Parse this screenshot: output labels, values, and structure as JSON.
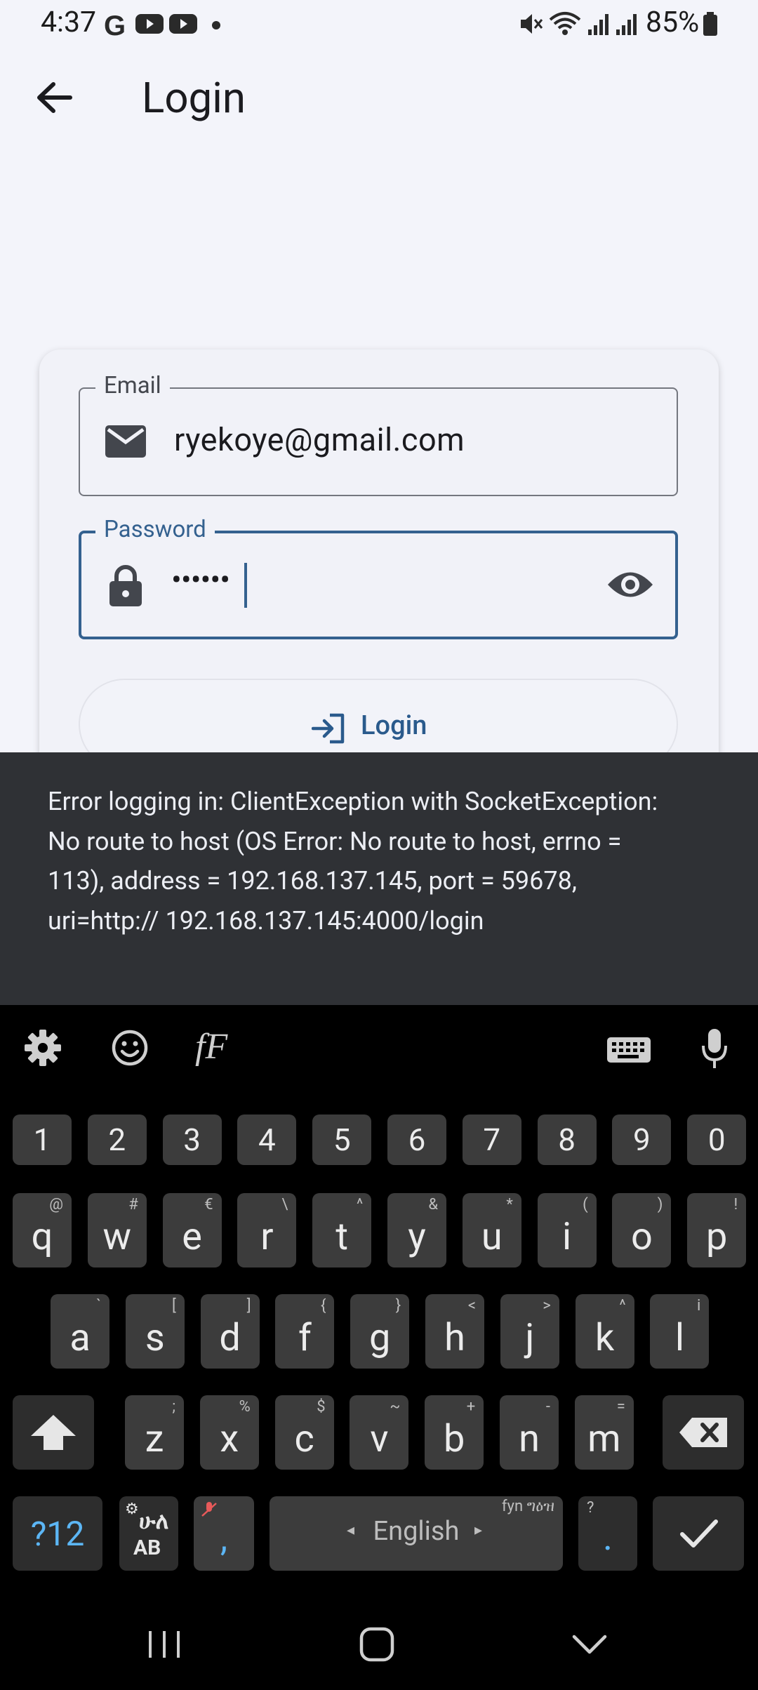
{
  "status_bar": {
    "time": "4:37",
    "battery": "85%",
    "notification_icons": [
      "google-icon",
      "youtube-icon",
      "youtube-icon",
      "dot-icon"
    ],
    "system_icons": [
      "mute-icon",
      "wifi-icon",
      "signal-icon",
      "signal-icon",
      "battery-icon"
    ]
  },
  "app_bar": {
    "title": "Login"
  },
  "form": {
    "email": {
      "label": "Email",
      "value": "ryekoye@gmail.com"
    },
    "password": {
      "label": "Password",
      "value": "••••••"
    },
    "login_button": "Login"
  },
  "snackbar": {
    "message": "Error logging in: ClientException with SocketException: No route to host (OS Error: No route to host, errno = 113), address = 192.168.137.145, port = 59678, uri=http:// 192.168.137.145:4000/login"
  },
  "keyboard": {
    "toolbar": {
      "font_label": "fF"
    },
    "number_row": [
      "1",
      "2",
      "3",
      "4",
      "5",
      "6",
      "7",
      "8",
      "9",
      "0"
    ],
    "row1": [
      {
        "k": "q",
        "s": "@"
      },
      {
        "k": "w",
        "s": "#"
      },
      {
        "k": "e",
        "s": "€"
      },
      {
        "k": "r",
        "s": "\\"
      },
      {
        "k": "t",
        "s": "^"
      },
      {
        "k": "y",
        "s": "&"
      },
      {
        "k": "u",
        "s": "*"
      },
      {
        "k": "i",
        "s": "("
      },
      {
        "k": "o",
        "s": ")"
      },
      {
        "k": "p",
        "s": "!"
      }
    ],
    "row2": [
      {
        "k": "a",
        "s": "`"
      },
      {
        "k": "s",
        "s": "["
      },
      {
        "k": "d",
        "s": "]"
      },
      {
        "k": "f",
        "s": "{"
      },
      {
        "k": "g",
        "s": "}"
      },
      {
        "k": "h",
        "s": "<"
      },
      {
        "k": "j",
        "s": ">"
      },
      {
        "k": "k",
        "s": "^"
      },
      {
        "k": "l",
        "s": "i"
      }
    ],
    "row3": [
      {
        "k": "z",
        "s": ";"
      },
      {
        "k": "x",
        "s": "%"
      },
      {
        "k": "c",
        "s": "$"
      },
      {
        "k": "v",
        "s": "~"
      },
      {
        "k": "b",
        "s": "+"
      },
      {
        "k": "n",
        "s": "-"
      },
      {
        "k": "m",
        "s": "="
      }
    ],
    "symbols_key": "?12",
    "lang_key_top": "ሁለ",
    "lang_key_bottom": "AB",
    "comma_key": ",",
    "space_label": "English",
    "space_hint": "fyn ግዕዝ",
    "period_hint": "?",
    "period_key": "."
  },
  "colors": {
    "accent": "#34618f",
    "snackbar_bg": "#2f3135",
    "keyboard_bg": "#000000",
    "key_bg": "#3c3c3c",
    "symbols_key_text": "#5cb6f5"
  }
}
